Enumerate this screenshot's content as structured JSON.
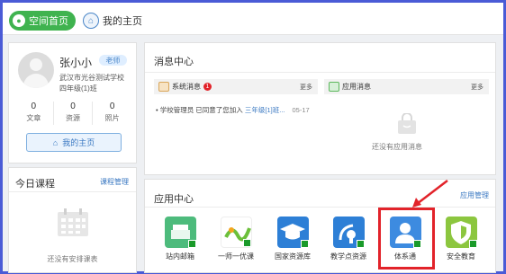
{
  "nav": {
    "home_label": "空间首页",
    "my_home_label": "我的主页"
  },
  "profile": {
    "name": "张小小",
    "role_badge": "老师",
    "school": "武汉市光谷测试学校",
    "class_name": "四年级(1)班",
    "stats": [
      {
        "value": "0",
        "label": "文章"
      },
      {
        "value": "0",
        "label": "资源"
      },
      {
        "value": "0",
        "label": "照片"
      }
    ],
    "my_home_button": "我的主页"
  },
  "courses": {
    "title": "今日课程",
    "manage_link": "课程管理",
    "empty_text": "还没有安排课表"
  },
  "messages": {
    "title": "消息中心",
    "system": {
      "label": "系统消息",
      "count": "1",
      "more": "更多"
    },
    "app": {
      "label": "应用消息",
      "more": "更多"
    },
    "item": {
      "prefix": "学校管理员 已同意了您加入 ",
      "link": "三年级[1]班...",
      "date": "05-17"
    },
    "empty_app_text": "还没有应用消息"
  },
  "app_center": {
    "title": "应用中心",
    "manage_link": "应用管理",
    "apps": [
      {
        "label": "站内邮箱",
        "icon": "mailbox-icon",
        "color": "#4dbb7c"
      },
      {
        "label": "一师一优课",
        "icon": "course-icon",
        "color": "#ffffff"
      },
      {
        "label": "国家资源库",
        "icon": "graduation-cap-icon",
        "color": "#2d7fd6"
      },
      {
        "label": "教学点资源",
        "icon": "satellite-icon",
        "color": "#2d7fd6"
      },
      {
        "label": "体系通",
        "icon": "user-icon",
        "color": "#3d8be0"
      },
      {
        "label": "安全教育",
        "icon": "shield-icon",
        "color": "#8cc63f"
      }
    ]
  },
  "colors": {
    "accent_green": "#3fb34f",
    "link_blue": "#3a78c2",
    "highlight_red": "#e2232a",
    "frame_blue": "#4a5bd6"
  }
}
